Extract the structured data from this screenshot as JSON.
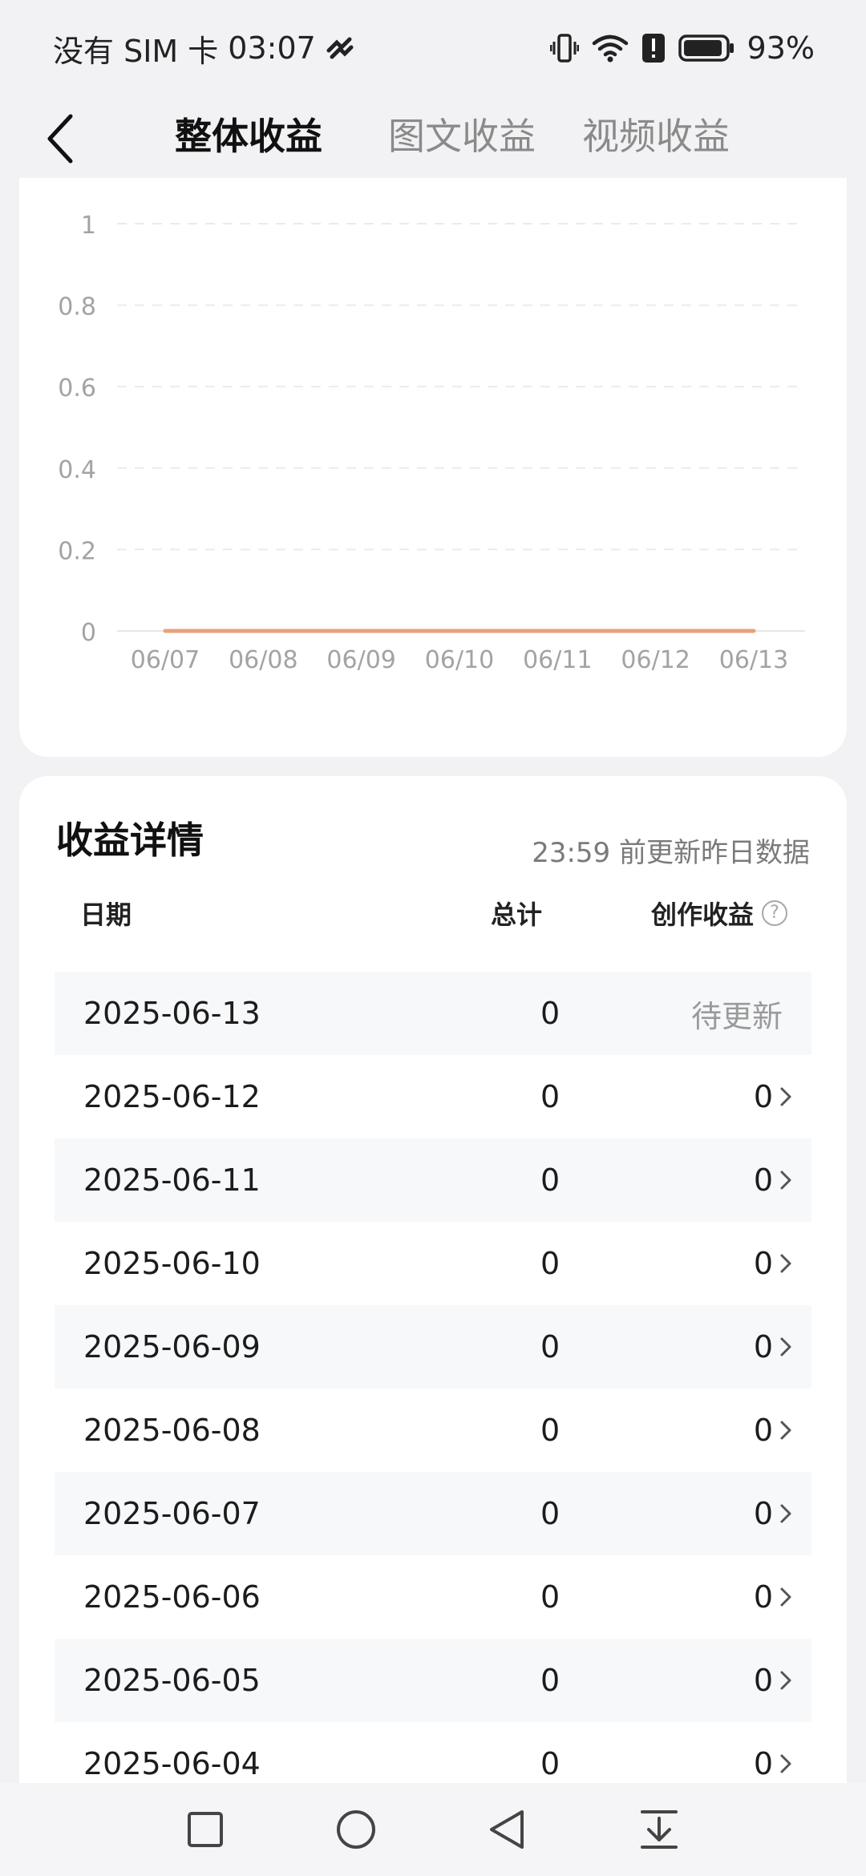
{
  "status_bar": {
    "carrier": "没有 SIM 卡",
    "time": "03:07",
    "battery": "93%",
    "battery_level": 0.93,
    "icons": [
      "link-icon",
      "vibrate-icon",
      "wifi-icon",
      "alert-icon",
      "battery-icon"
    ]
  },
  "nav": {
    "back_icon": "back-arrow-icon",
    "tabs": [
      {
        "label": "整体收益",
        "active": true
      },
      {
        "label": "图文收益",
        "active": false
      },
      {
        "label": "视频收益",
        "active": false
      }
    ]
  },
  "chart_data": {
    "type": "line",
    "categories": [
      "06/07",
      "06/08",
      "06/09",
      "06/10",
      "06/11",
      "06/12",
      "06/13"
    ],
    "series": [
      {
        "values": [
          0,
          0,
          0,
          0,
          0,
          0,
          0
        ],
        "color": "#e8a27c"
      }
    ],
    "ylim": [
      0,
      1
    ],
    "yticks": [
      "0",
      "0.2",
      "0.4",
      "0.6",
      "0.8",
      "1"
    ],
    "grid": true
  },
  "details": {
    "title": "收益详情",
    "note": "23:59 前更新昨日数据",
    "headers": {
      "date": "日期",
      "total": "总计",
      "creation": "创作收益"
    },
    "help_icon": "help-circle-icon",
    "rows": [
      {
        "date": "2025-06-13",
        "total": "0",
        "creation": "待更新",
        "pending": true
      },
      {
        "date": "2025-06-12",
        "total": "0",
        "creation": "0",
        "pending": false
      },
      {
        "date": "2025-06-11",
        "total": "0",
        "creation": "0",
        "pending": false
      },
      {
        "date": "2025-06-10",
        "total": "0",
        "creation": "0",
        "pending": false
      },
      {
        "date": "2025-06-09",
        "total": "0",
        "creation": "0",
        "pending": false
      },
      {
        "date": "2025-06-08",
        "total": "0",
        "creation": "0",
        "pending": false
      },
      {
        "date": "2025-06-07",
        "total": "0",
        "creation": "0",
        "pending": false
      },
      {
        "date": "2025-06-06",
        "total": "0",
        "creation": "0",
        "pending": false
      },
      {
        "date": "2025-06-05",
        "total": "0",
        "creation": "0",
        "pending": false
      },
      {
        "date": "2025-06-04",
        "total": "0",
        "creation": "0",
        "pending": false
      }
    ]
  },
  "system_nav": [
    "square-recents-icon",
    "circle-home-icon",
    "triangle-back-icon",
    "pull-down-icon"
  ]
}
